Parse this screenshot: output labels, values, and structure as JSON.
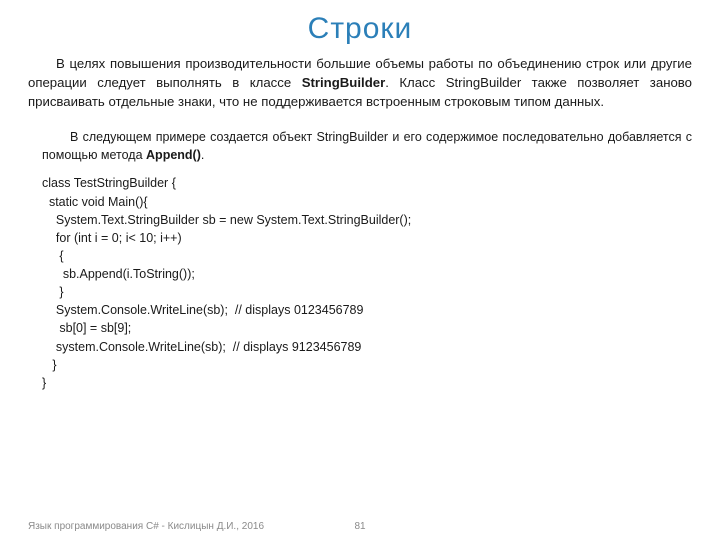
{
  "title": "Строки",
  "para1_pre": "В целях повышения производительности большие объемы работы по объединению строк или другие операции следует выполнять в классе ",
  "para1_bold": "StringBuilder",
  "para1_post": ". Класс StringBuilder также позволяет заново присваивать отдельные знаки, что не поддерживается встроенным строковым типом данных.",
  "para2_pre": "В следующем примере создается объект StringBuilder и его содержимое последовательно добавляется с помощью метода ",
  "para2_bold": "Append()",
  "para2_post": ".",
  "code": "class TestStringBuilder {\n  static void Main(){\n    System.Text.StringBuilder sb = new System.Text.StringBuilder();\n    for (int i = 0; i< 10; i++)\n     {\n      sb.Append(i.ToString());\n     }\n    System.Console.WriteLine(sb);  // displays 0123456789\n     sb[0] = sb[9];\n    system.Console.WriteLine(sb);  // displays 9123456789\n   }\n}",
  "footer_left": "Язык программирования C# - Кислицын Д.И., 2016",
  "page_number": "81"
}
